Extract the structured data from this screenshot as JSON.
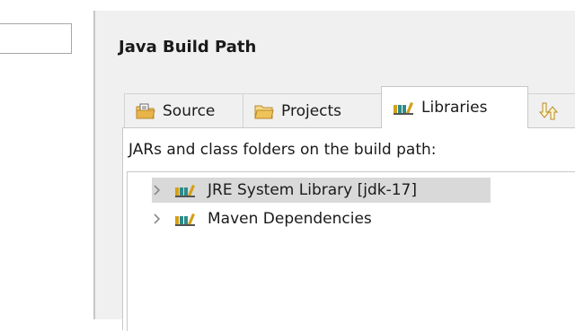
{
  "page": {
    "title": "Java Build Path"
  },
  "tabs": [
    {
      "label": "Source",
      "icon": "source-folder-icon",
      "active": false
    },
    {
      "label": "Projects",
      "icon": "folder-icon",
      "active": false
    },
    {
      "label": "Libraries",
      "icon": "library-icon",
      "active": true
    },
    {
      "label": "",
      "icon": "order-export-icon",
      "active": false
    }
  ],
  "libraries": {
    "section_label": "JARs and class folders on the build path:",
    "items": [
      {
        "label": "JRE System Library [jdk-17]",
        "icon": "library-icon",
        "selected": true
      },
      {
        "label": "Maven Dependencies",
        "icon": "library-icon",
        "selected": false
      }
    ]
  },
  "colors": {
    "panel_bg": "#f0f0f0",
    "selection_bg": "#d9d9d9",
    "library_icon_teal": "#2e8b8b",
    "library_icon_gold": "#d4a017"
  }
}
